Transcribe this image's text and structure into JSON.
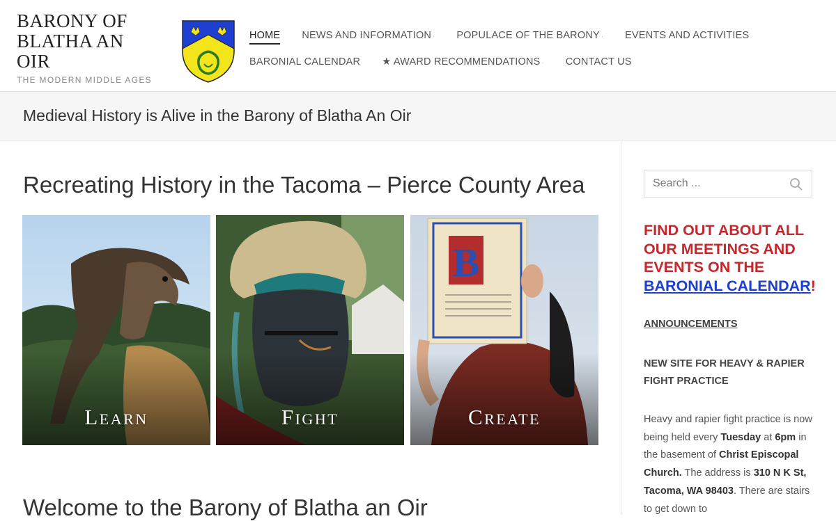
{
  "site": {
    "title": "BARONY OF BLATHA AN OIR",
    "tagline": "THE MODERN MIDDLE AGES"
  },
  "nav": {
    "row1": [
      {
        "label": "HOME",
        "active": true,
        "dropdown": false
      },
      {
        "label": "NEWS AND INFORMATION",
        "active": false,
        "dropdown": true
      },
      {
        "label": "POPULACE OF THE BARONY",
        "active": false,
        "dropdown": true
      },
      {
        "label": "EVENTS AND ACTIVITIES",
        "active": false,
        "dropdown": true
      }
    ],
    "row2": [
      {
        "label": "BARONIAL CALENDAR",
        "active": false,
        "dropdown": false
      },
      {
        "label": "★ AWARD RECOMMENDATIONS",
        "active": false,
        "dropdown": true
      },
      {
        "label": "CONTACT US",
        "active": false,
        "dropdown": false
      }
    ]
  },
  "banner": {
    "text": "Medieval History is Alive in the Barony of Blatha An Oir"
  },
  "main": {
    "heading": "Recreating History in the Tacoma – Pierce County Area",
    "tiles": [
      {
        "label": "Learn",
        "image": "falcon-on-glove"
      },
      {
        "label": "Fight",
        "image": "plumed-knight-helm"
      },
      {
        "label": "Create",
        "image": "illuminated-scroll"
      }
    ],
    "welcome": "Welcome to the Barony of Blatha an Oir"
  },
  "sidebar": {
    "search_placeholder": "Search ...",
    "promo_text": "FIND OUT ABOUT ALL OUR MEETINGS AND EVENTS ON THE",
    "promo_link": "BARONIAL CALENDAR",
    "promo_end": "!",
    "announcements": "ANNOUNCEMENTS",
    "news_title": "NEW SITE FOR HEAVY & RAPIER FIGHT PRACTICE",
    "news_body": {
      "t1": "Heavy and rapier fight practice is now being held every ",
      "b1": "Tuesday",
      "t2": " at ",
      "b2": "6pm",
      "t3": " in the basement of ",
      "b3": "Christ Episcopal Church.",
      "t4": " The address is ",
      "b4": "310 N K St, Tacoma, WA 98403",
      "t5": ". There are stairs to get down to"
    }
  },
  "colors": {
    "promo_red": "#c3282d",
    "link_blue": "#1d3fcf",
    "crest_blue": "#1e3fcf",
    "crest_yellow": "#f3e51b"
  }
}
